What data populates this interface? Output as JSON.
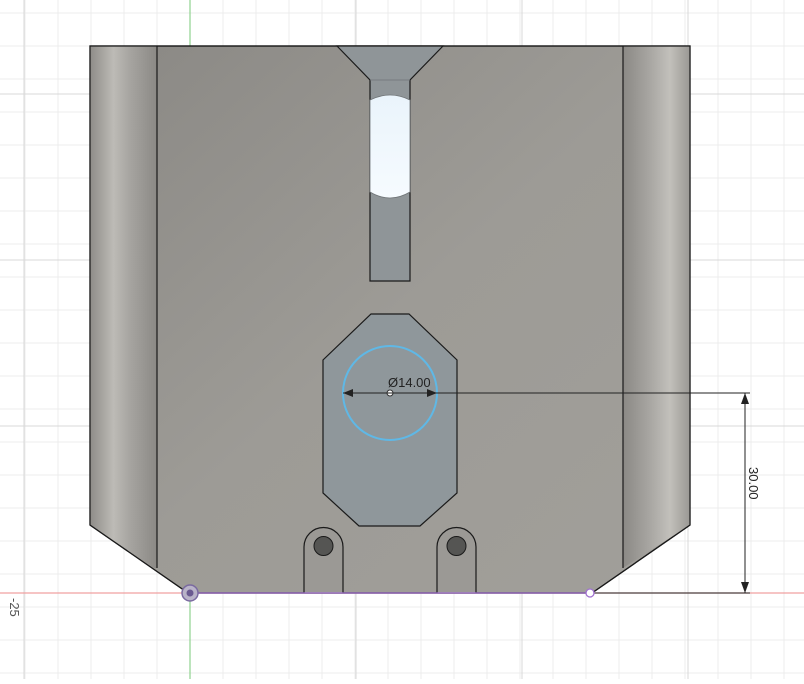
{
  "viewport": {
    "grid_label": "-25",
    "diameter_dimension": "Ø14.00",
    "vertical_dimension": "30.00"
  },
  "colors": {
    "background": "#ffffff",
    "grid_minor": "#ececec",
    "grid_major": "#dcdcdc",
    "axis_green": "#8fd18f",
    "axis_red": "#f0a0a0",
    "part_gray": "#9c9a95",
    "sketch_cyan": "#5fb8e6",
    "sketch_purple": "#a070d0",
    "dimension_line": "#222222"
  }
}
